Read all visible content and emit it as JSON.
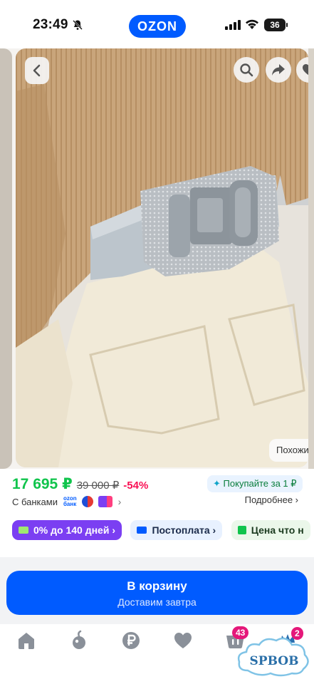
{
  "status_bar": {
    "time": "23:49",
    "app_logo": "OZON",
    "battery": "36",
    "icons": [
      "bell-off-icon",
      "signal-icon",
      "wifi-icon",
      "battery-icon"
    ]
  },
  "gallery": {
    "similar_label": "Похожие",
    "icons": [
      "chevron-left-icon",
      "search-icon",
      "share-icon",
      "heart-icon"
    ]
  },
  "price": {
    "current": "17 695 ₽",
    "old": "39 000 ₽",
    "discount": "-54%",
    "buy_for": "Покупайте за 1 ₽",
    "banks_label": "С банками",
    "ozon_bank_line1": "ozon",
    "ozon_bank_line2": "банк",
    "more_label": "Подробнее ›"
  },
  "chips": [
    {
      "label": "0% до 140 дней ›",
      "color": "#7b3ff2"
    },
    {
      "label": "Постоплата ›",
      "color": "#005bff"
    },
    {
      "label": "Цена что н",
      "color": "#10c44c"
    }
  ],
  "cart": {
    "title": "В корзину",
    "subtitle": "Доставим завтра"
  },
  "nav": {
    "items": [
      "home-icon",
      "fresh-icon",
      "ruble-icon",
      "favorites-icon",
      "cart-icon",
      "profile-icon"
    ],
    "cart_badge": "43",
    "profile_badge": "2"
  },
  "watermark": "SPBOB",
  "colors": {
    "brand": "#005bff",
    "price": "#10c44c",
    "discount": "#f91155",
    "badge": "#e5187a"
  }
}
